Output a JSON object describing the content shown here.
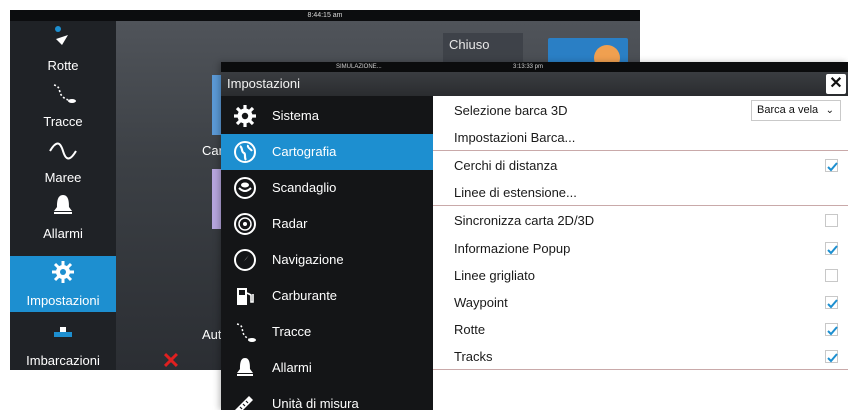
{
  "background_screen": {
    "status_time": "8:44:15 am",
    "chiuso_label": "Chiuso",
    "sidebar": [
      {
        "label": "Rotte",
        "icon": "route-icon"
      },
      {
        "label": "Tracce",
        "icon": "trail-icon"
      },
      {
        "label": "Maree",
        "icon": "tide-wave-icon"
      },
      {
        "label": "Allarmi",
        "icon": "bell-icon"
      },
      {
        "label": "Impostazioni",
        "icon": "gear-icon",
        "active": true
      },
      {
        "label": "Imbarcazioni",
        "icon": "vessel-icon"
      }
    ],
    "fragment_car": "Car",
    "fragment_aut": "Aut"
  },
  "dialog": {
    "simulation_label": "SIMULAZIONE...",
    "status_time": "3:13:33 pm",
    "title": "Impostazioni",
    "close_glyph": "✕",
    "menu": [
      {
        "label": "Sistema",
        "icon": "gear-icon"
      },
      {
        "label": "Cartografia",
        "icon": "chart-globe-icon",
        "active": true
      },
      {
        "label": "Scandaglio",
        "icon": "sonar-icon"
      },
      {
        "label": "Radar",
        "icon": "radar-icon"
      },
      {
        "label": "Navigazione",
        "icon": "compass-icon"
      },
      {
        "label": "Carburante",
        "icon": "fuel-pump-icon"
      },
      {
        "label": "Tracce",
        "icon": "trail-icon"
      },
      {
        "label": "Allarmi",
        "icon": "bell-icon"
      },
      {
        "label": "Unità di misura",
        "icon": "ruler-icon"
      }
    ],
    "settings": {
      "boat_3d": {
        "label": "Selezione barca 3D",
        "value": "Barca a vela"
      },
      "boat_settings": {
        "label": "Impostazioni Barca..."
      },
      "range_rings": {
        "label": "Cerchi di distanza",
        "checked": true
      },
      "extension_lines": {
        "label": "Linee di estensione..."
      },
      "sync_2d3d": {
        "label": "Sincronizza carta 2D/3D",
        "checked": false
      },
      "popup_info": {
        "label": "Informazione Popup",
        "checked": true
      },
      "grid_lines": {
        "label": "Linee grigliato",
        "checked": false
      },
      "waypoint": {
        "label": "Waypoint",
        "checked": true
      },
      "routes": {
        "label": "Rotte",
        "checked": true
      },
      "tracks": {
        "label": "Tracks",
        "checked": true
      }
    }
  },
  "colors": {
    "accent_blue": "#1d8fd0",
    "menu_bg": "#141517",
    "checkmark": "#1d8fd0",
    "close_x_red": "#e02020"
  }
}
